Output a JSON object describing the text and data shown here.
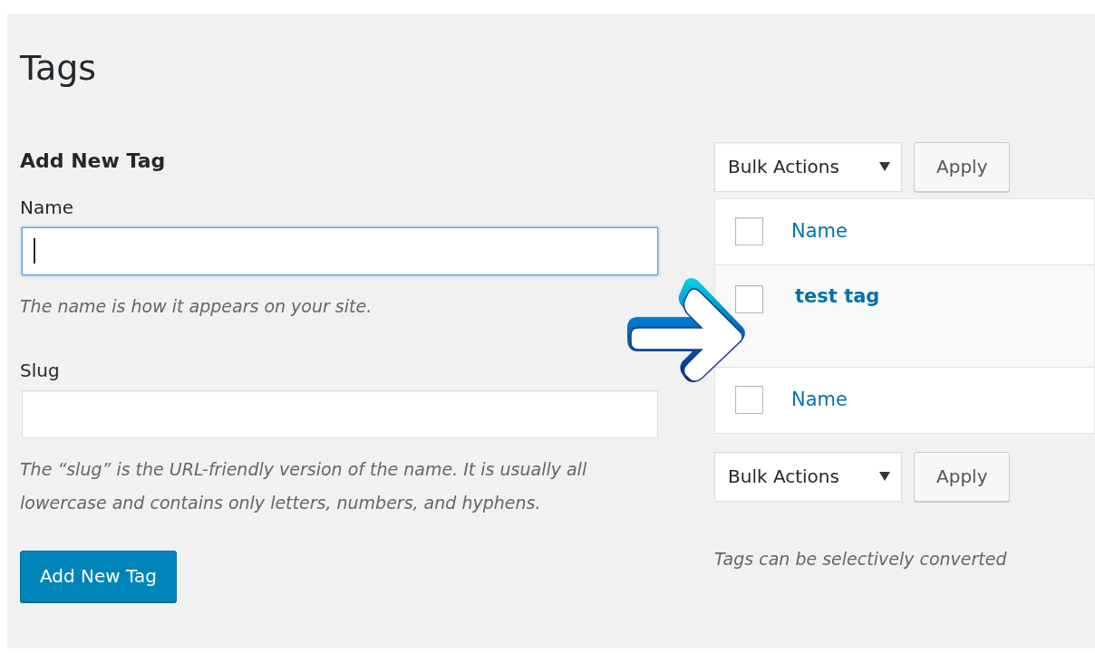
{
  "page_title": "Tags",
  "add_form": {
    "heading": "Add New Tag",
    "fields": [
      {
        "label": "Name",
        "focused": true,
        "hint": "The name is how it appears on your site."
      },
      {
        "label": "Slug",
        "focused": false,
        "hint": "The “slug” is the URL-friendly version of the name. It is usually all lowercase and contains only letters, numbers, and hyphens."
      }
    ],
    "submit": "Add New Tag"
  },
  "tags_table": {
    "bulk_top": {
      "select": "Bulk Actions",
      "button": "Apply"
    },
    "header": {
      "label": "Name",
      "checked": false
    },
    "rows": [
      {
        "name": "test tag",
        "checked": false
      }
    ],
    "footer": {
      "label": "Name",
      "checked": false
    },
    "bulk_bottom": {
      "select": "Bulk Actions",
      "button": "Apply"
    },
    "note": "Tags can be selectively converted"
  }
}
